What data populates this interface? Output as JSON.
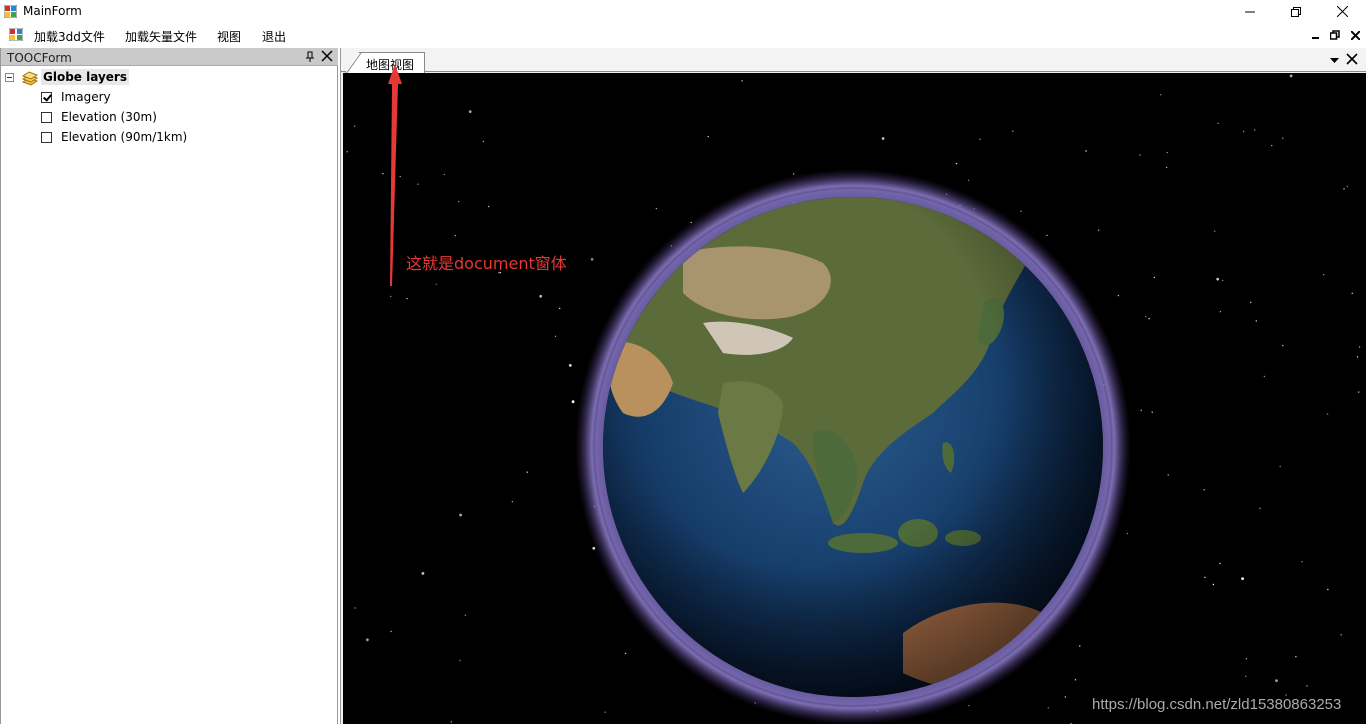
{
  "window": {
    "title": "MainForm",
    "icon": "winforms-app-icon"
  },
  "menu": {
    "items": [
      "加载3dd文件",
      "加载矢量文件",
      "视图",
      "退出"
    ]
  },
  "toc": {
    "title": "TOOCForm",
    "root_label": "Globe layers",
    "layers": [
      {
        "label": "Imagery",
        "checked": true
      },
      {
        "label": "Elevation (30m)",
        "checked": false
      },
      {
        "label": "Elevation (90m/1km)",
        "checked": false
      }
    ]
  },
  "document": {
    "tab_label": "地图视图"
  },
  "annotation": {
    "text": "这就是document窗体",
    "color": "#e53935"
  },
  "watermark": "https://blog.csdn.net/zld15380863253"
}
